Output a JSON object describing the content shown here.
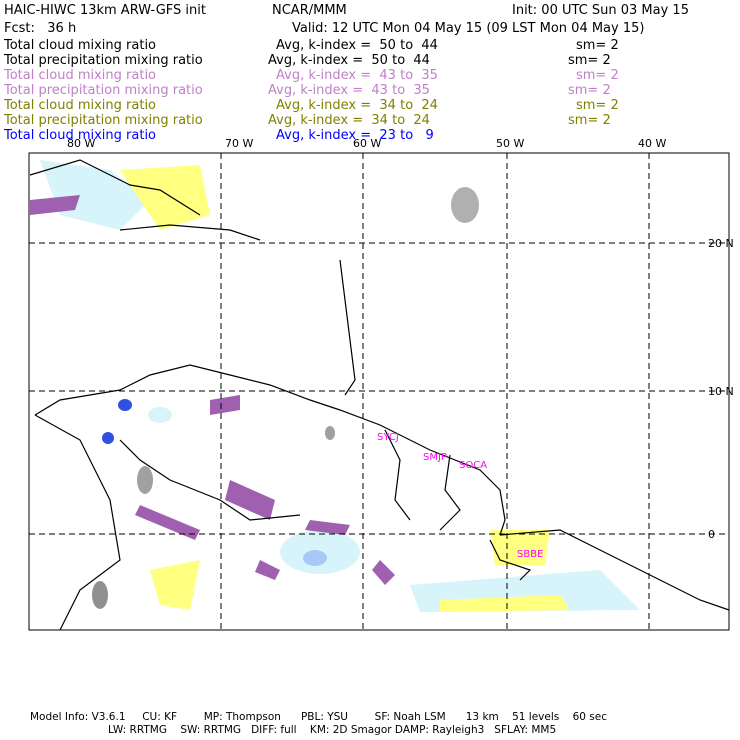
{
  "header": {
    "title": "HAIC-HIWC 13km ARW-GFS init",
    "org": "NCAR/MMM",
    "init": "Init: 00 UTC Sun 03 May 15",
    "fcst": "Fcst:   36 h",
    "valid": "Valid: 12 UTC Mon 04 May 15 (09 LST Mon 04 May 15)"
  },
  "legend": [
    {
      "field": "Total cloud mixing ratio",
      "avg": "Avg, k-index =  50 to  44",
      "sm": "sm= 2",
      "color": "#000000"
    },
    {
      "field": "Total precipitation mixing ratio",
      "avg": "Avg, k-index =  50 to  44",
      "sm": "sm= 2",
      "color": "#000000"
    },
    {
      "field": "Total cloud mixing ratio",
      "avg": "Avg, k-index =  43 to  35",
      "sm": "sm= 2",
      "color": "#c080c8"
    },
    {
      "field": "Total precipitation mixing ratio",
      "avg": "Avg, k-index =  43 to  35",
      "sm": "sm= 2",
      "color": "#c080c8"
    },
    {
      "field": "Total cloud mixing ratio",
      "avg": "Avg, k-index =  34 to  24",
      "sm": "sm= 2",
      "color": "#808000"
    },
    {
      "field": "Total precipitation mixing ratio",
      "avg": "Avg, k-index =  34 to  24",
      "sm": "sm= 2",
      "color": "#808000"
    },
    {
      "field": "Total cloud mixing ratio",
      "avg": "Avg, k-index =  23 to   9",
      "sm": "",
      "color": "#0000ff"
    }
  ],
  "map": {
    "lon_labels": [
      "80 W",
      "70 W",
      "60 W",
      "50 W",
      "40 W"
    ],
    "lat_labels": [
      "20 N",
      "10 N",
      "0"
    ],
    "stations": [
      "SYCJ",
      "SMJP",
      "SOCA",
      "SBBE"
    ]
  },
  "footer": {
    "line1": "Model Info: V3.6.1     CU: KF        MP: Thompson      PBL: YSU        SF: Noah LSM      13 km    51 levels    60 sec",
    "line2": "LW: RRTMG    SW: RRTMG   DIFF: full    KM: 2D Smagor DAMP: Rayleigh3   SFLAY: MM5"
  }
}
